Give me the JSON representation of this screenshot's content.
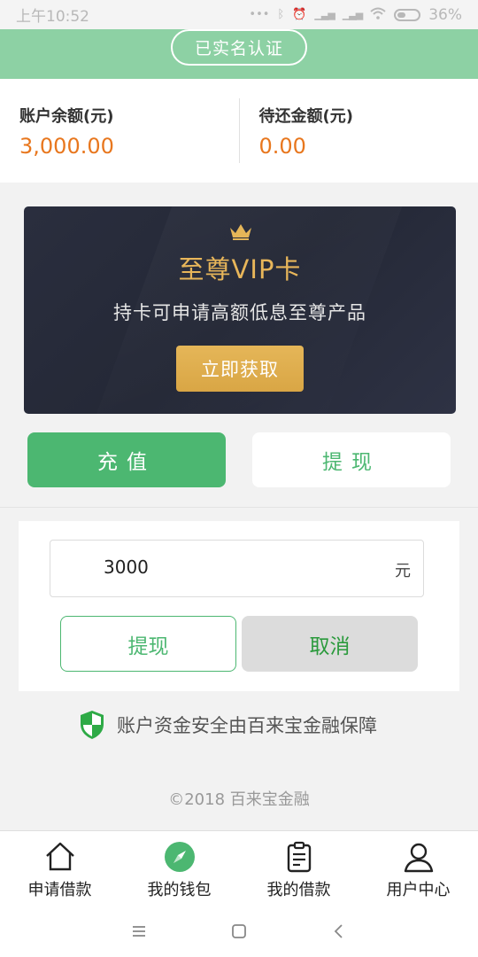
{
  "status_bar": {
    "time": "上午10:52",
    "battery": "36%",
    "icons": [
      "dots-icon",
      "bluetooth-icon",
      "alarm-icon",
      "signal-icon",
      "signal-icon",
      "wifi-icon",
      "battery-icon"
    ]
  },
  "header": {
    "verify_badge": "已实名认证",
    "accent_color": "#8dd1a4"
  },
  "balance": {
    "account_label": "账户余额(元)",
    "account_value": "3,000.00",
    "due_label": "待还金额(元)",
    "due_value": "0.00",
    "value_color": "#e8771e"
  },
  "vip": {
    "icon": "crown-icon",
    "title": "至尊VIP卡",
    "subtitle": "持卡可申请高额低息至尊产品",
    "button": "立即获取"
  },
  "actions": {
    "recharge": "充值",
    "withdraw": "提现",
    "primary_color": "#4cb771"
  },
  "withdraw_form": {
    "amount_value": "3000",
    "unit": "元",
    "confirm": "提现",
    "cancel": "取消"
  },
  "security_note": "账户资金安全由百来宝金融保障",
  "copyright": "©2018 百来宝金融",
  "tabbar": {
    "items": [
      {
        "label": "申请借款",
        "icon": "home-icon"
      },
      {
        "label": "我的钱包",
        "icon": "compass-icon"
      },
      {
        "label": "我的借款",
        "icon": "clipboard-icon"
      },
      {
        "label": "用户中心",
        "icon": "user-icon"
      }
    ]
  }
}
